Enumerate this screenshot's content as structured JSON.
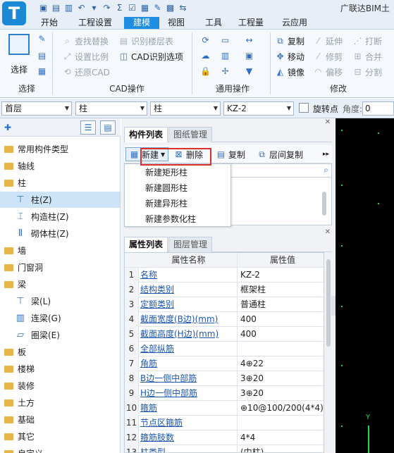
{
  "app": {
    "title": "广联达BIM土",
    "logo": "T"
  },
  "qat_icons": [
    "save-icon",
    "open-icon",
    "folder-icon",
    "undo-icon",
    "redo-icon",
    "sum-icon",
    "check-icon",
    "layout-icon",
    "edit-icon",
    "grid-icon",
    "swap-icon",
    "more-icon"
  ],
  "qat_glyphs": [
    "▣",
    "▤",
    "▥",
    "↶",
    "▾",
    "↷",
    "Σ",
    "☑",
    "▦",
    "✎",
    "▩",
    "⇆"
  ],
  "tabs": [
    {
      "label": "开始"
    },
    {
      "label": "工程设置"
    },
    {
      "label": "建模"
    },
    {
      "label": "视图"
    },
    {
      "label": "工具"
    },
    {
      "label": "工程量"
    },
    {
      "label": "云应用"
    }
  ],
  "active_tab": "建模",
  "ribbon": {
    "select": {
      "label": "选择",
      "group": "选择"
    },
    "cad": {
      "group": "CAD操作",
      "items": [
        {
          "label": "查找替换",
          "disabled": true
        },
        {
          "label": "识别楼层表",
          "disabled": true
        },
        {
          "label": "设置比例",
          "disabled": true
        },
        {
          "label": "CAD识别选项",
          "disabled": false
        },
        {
          "label": "还原CAD",
          "disabled": true
        }
      ]
    },
    "general": {
      "group": "通用操作"
    },
    "modify": {
      "group": "修改",
      "items": [
        {
          "label": "复制",
          "disabled": false
        },
        {
          "label": "延伸",
          "disabled": true
        },
        {
          "label": "打断",
          "disabled": true
        },
        {
          "label": "移动",
          "disabled": false
        },
        {
          "label": "修剪",
          "disabled": true
        },
        {
          "label": "合并",
          "disabled": true
        },
        {
          "label": "镜像",
          "disabled": false
        },
        {
          "label": "偏移",
          "disabled": true
        },
        {
          "label": "分割",
          "disabled": true
        }
      ]
    }
  },
  "filters": {
    "floor": "首层",
    "category": "柱",
    "type": "柱",
    "component": "KZ-2",
    "rotate_label": "旋转点",
    "angle_label": "角度:",
    "angle_value": "0"
  },
  "tree": {
    "nodes": [
      {
        "label": "常用构件类型",
        "child": false
      },
      {
        "label": "轴线",
        "child": false
      },
      {
        "label": "柱",
        "child": false
      },
      {
        "label": "柱(Z)",
        "child": true,
        "selected": true,
        "icon": "column-icon",
        "glyph": "⊤"
      },
      {
        "label": "构造柱(Z)",
        "child": true,
        "icon": "struct-column-icon",
        "glyph": "⌶"
      },
      {
        "label": "砌体柱(Z)",
        "child": true,
        "icon": "masonry-column-icon",
        "glyph": "Ⅱ"
      },
      {
        "label": "墙",
        "child": false
      },
      {
        "label": "门窗洞",
        "child": false
      },
      {
        "label": "梁",
        "child": false
      },
      {
        "label": "梁(L)",
        "child": true,
        "icon": "beam-icon",
        "glyph": "⊤"
      },
      {
        "label": "连梁(G)",
        "child": true,
        "icon": "link-beam-icon",
        "glyph": "▥"
      },
      {
        "label": "圈梁(E)",
        "child": true,
        "icon": "ring-beam-icon",
        "glyph": "▱"
      },
      {
        "label": "板",
        "child": false
      },
      {
        "label": "楼梯",
        "child": false
      },
      {
        "label": "装修",
        "child": false
      },
      {
        "label": "土方",
        "child": false
      },
      {
        "label": "基础",
        "child": false
      },
      {
        "label": "其它",
        "child": false
      },
      {
        "label": "自定义",
        "child": false
      }
    ]
  },
  "component_panel": {
    "tabs": [
      "构件列表",
      "图纸管理"
    ],
    "toolbar": {
      "new": "新建",
      "delete": "删除",
      "copy": "复制",
      "floor_copy": "层间复制"
    },
    "dropdown": [
      "新建矩形柱",
      "新建圆形柱",
      "新建异形柱",
      "新建参数化柱"
    ],
    "highlighted": "新建异形柱"
  },
  "property_panel": {
    "tabs": [
      "属性列表",
      "图层管理"
    ],
    "headers": {
      "name": "属性名称",
      "value": "属性值"
    },
    "rows": [
      {
        "num": "1",
        "name": "名称",
        "value": "KZ-2"
      },
      {
        "num": "2",
        "name": "结构类别",
        "value": "框架柱"
      },
      {
        "num": "3",
        "name": "定额类别",
        "value": "普通柱"
      },
      {
        "num": "4",
        "name": "截面宽度(B边)(mm)",
        "value": "400"
      },
      {
        "num": "5",
        "name": "截面高度(H边)(mm)",
        "value": "400"
      },
      {
        "num": "6",
        "name": "全部纵筋",
        "value": ""
      },
      {
        "num": "7",
        "name": "角筋",
        "value": "4⊕22"
      },
      {
        "num": "8",
        "name": "B边一侧中部筋",
        "value": "3⊕20"
      },
      {
        "num": "9",
        "name": "H边一侧中部筋",
        "value": "3⊕20"
      },
      {
        "num": "10",
        "name": "箍筋",
        "value": "⊕10@100/200(4*4)"
      },
      {
        "num": "11",
        "name": "节点区箍筋",
        "value": ""
      },
      {
        "num": "12",
        "name": "箍筋肢数",
        "value": "4*4"
      },
      {
        "num": "13",
        "name": "柱类型",
        "value": "(中柱)"
      }
    ]
  },
  "canvas": {
    "axis_label": "Y"
  }
}
